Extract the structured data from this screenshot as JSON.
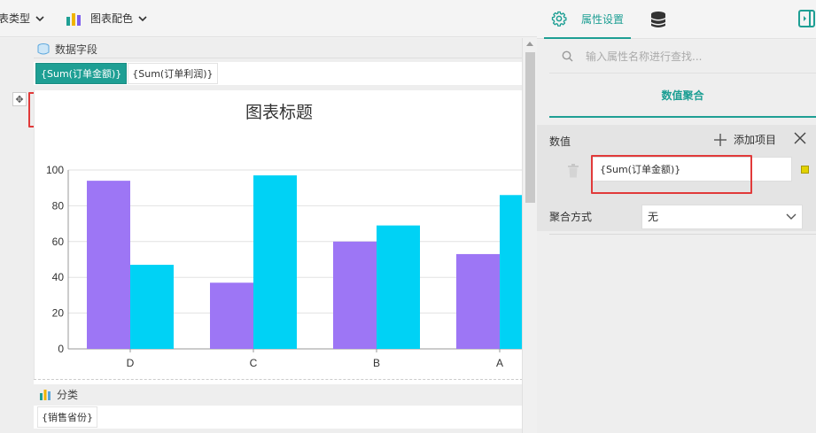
{
  "toolbar": {
    "chart_type_label": "表类型",
    "palette_label": "图表配色"
  },
  "design": {
    "field_header": "数据字段",
    "data_fields": [
      "{Sum(订单金额)}",
      "{Sum(订单利润)}"
    ],
    "category_header": "分类",
    "category_field": "{销售省份}"
  },
  "chart_data": {
    "type": "bar",
    "title": "图表标题",
    "categories": [
      "D",
      "C",
      "B",
      "A"
    ],
    "series": [
      {
        "values": [
          94,
          37,
          60,
          53
        ],
        "color": "#9d76f5"
      },
      {
        "values": [
          47,
          97,
          69,
          86
        ],
        "color": "#00d2f5"
      }
    ],
    "ylim": [
      0,
      100
    ],
    "yticks": [
      0,
      20,
      40,
      60,
      80,
      100
    ],
    "grid": true,
    "xlabel": "",
    "ylabel": ""
  },
  "panel": {
    "tab_props": "属性设置",
    "search_placeholder": "输入属性名称进行查找...",
    "section_title": "数值聚合",
    "values_label": "数值",
    "add_item": "添加项目",
    "value_field": "{Sum(订单金额)}",
    "value_color": "#e2d200",
    "agg_label": "聚合方式",
    "agg_value": "无"
  },
  "colors": {
    "accent": "#1e9f94",
    "highlight": "#e13a3a"
  }
}
